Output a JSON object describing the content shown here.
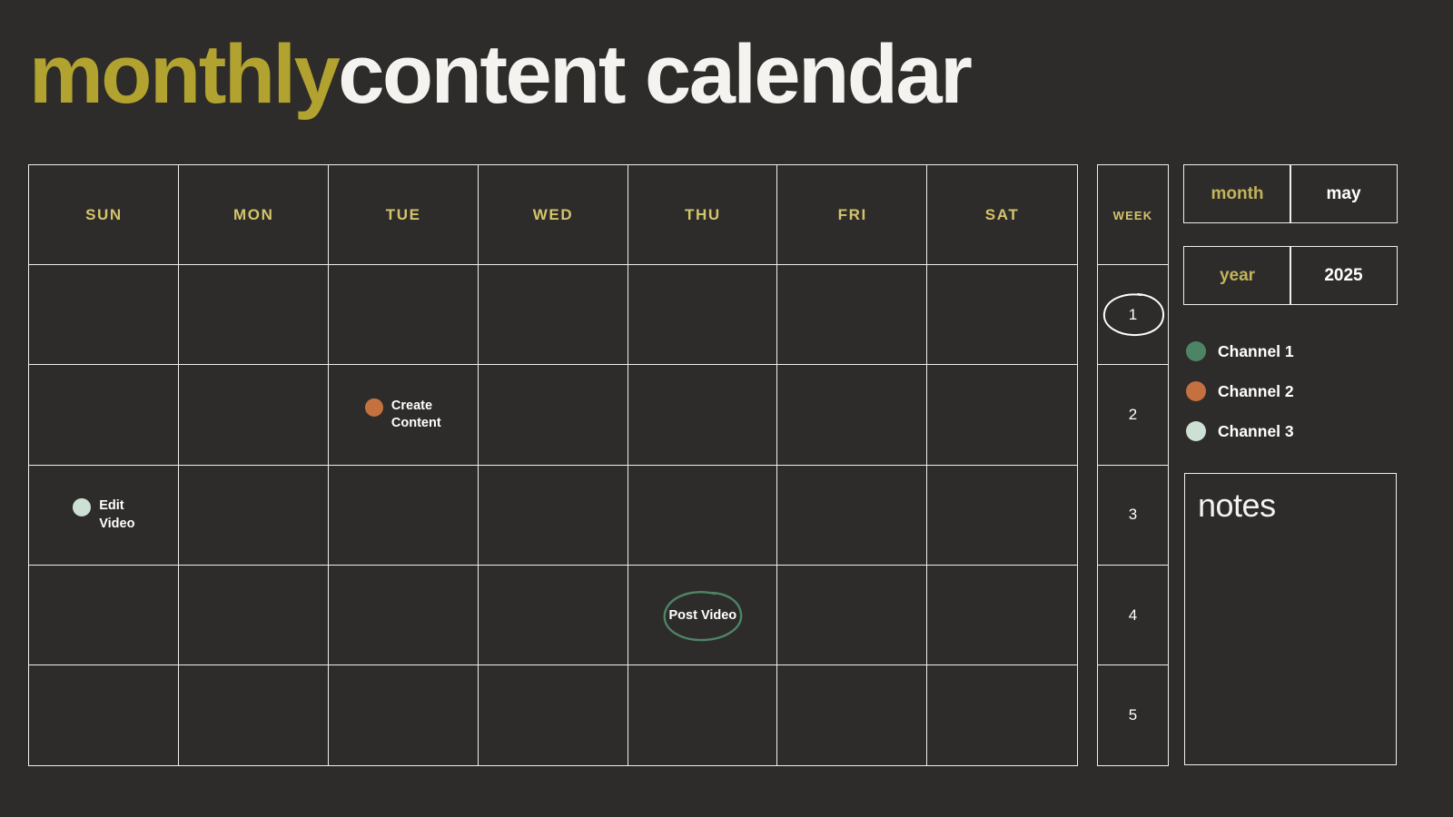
{
  "page": {
    "background_color": "#2e2c2a",
    "border_color": "#f0efe9"
  },
  "title": {
    "part1": "monthly",
    "part1_color": "#b2a22f",
    "part2": "content calendar",
    "part2_color": "#f4f3ef"
  },
  "calendar": {
    "day_headers": [
      "SUN",
      "MON",
      "TUE",
      "WED",
      "THU",
      "FRI",
      "SAT"
    ],
    "day_header_color": "#d3c46c",
    "rows": 5,
    "events": [
      {
        "row": 2,
        "day": "TUE",
        "label": "Create\nContent",
        "channel": "Channel 2",
        "color": "#c4713f",
        "style": "dot"
      },
      {
        "row": 3,
        "day": "SUN",
        "label": "Edit\nVideo",
        "channel": "Channel 3",
        "color": "#cde0d4",
        "style": "dot"
      },
      {
        "row": 4,
        "day": "THU",
        "label": "Post Video",
        "channel": "Channel 1",
        "color": "#4e8466",
        "style": "circled"
      }
    ]
  },
  "week_column": {
    "header": "WEEK",
    "header_color": "#d3c46c",
    "weeks": [
      {
        "number": "1",
        "highlighted": true,
        "highlight_color": "#ffffff"
      },
      {
        "number": "2",
        "highlighted": false
      },
      {
        "number": "3",
        "highlighted": false
      },
      {
        "number": "4",
        "highlighted": false
      },
      {
        "number": "5",
        "highlighted": false
      }
    ]
  },
  "side_panel": {
    "month_field": {
      "key": "month",
      "value": "may"
    },
    "year_field": {
      "key": "year",
      "value": "2025"
    },
    "legend": [
      {
        "label": "Channel 1",
        "color": "#4e8466"
      },
      {
        "label": "Channel 2",
        "color": "#c4713f"
      },
      {
        "label": "Channel 3",
        "color": "#cde0d4"
      }
    ],
    "notes": {
      "title": "notes",
      "content": ""
    }
  }
}
